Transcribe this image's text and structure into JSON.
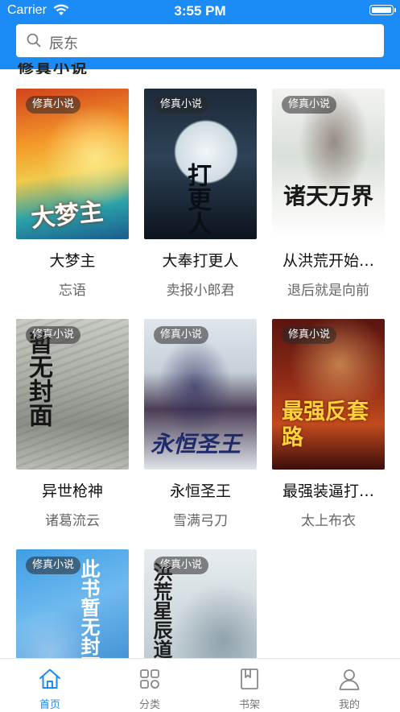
{
  "status_bar": {
    "carrier": "Carrier",
    "time": "3:55 PM"
  },
  "search": {
    "text": "辰东",
    "icon": "search-icon"
  },
  "section_title_partial": "修真小说",
  "books": [
    {
      "tag": "修真小说",
      "title": "大梦主",
      "author": "忘语",
      "cover_text": "大梦主"
    },
    {
      "tag": "修真小说",
      "title": "大奉打更人",
      "author": "卖报小郎君",
      "cover_text": "打更人"
    },
    {
      "tag": "修真小说",
      "title": "从洪荒开始…",
      "author": "退后就是向前",
      "cover_text": "诸天万界"
    },
    {
      "tag": "修真小说",
      "title": "异世枪神",
      "author": "诸葛流云",
      "cover_text": "暂无封面"
    },
    {
      "tag": "修真小说",
      "title": "永恒圣王",
      "author": "雪满弓刀",
      "cover_text": "永恒圣王"
    },
    {
      "tag": "修真小说",
      "title": "最强装逼打…",
      "author": "太上布衣",
      "cover_text": "最强反套路"
    },
    {
      "tag": "修真小说",
      "title": "",
      "author": "",
      "cover_text": "此书暂无封面"
    },
    {
      "tag": "修真小说",
      "title": "",
      "author": "",
      "cover_text": "洪荒星辰道"
    }
  ],
  "tabs": [
    {
      "label": "首页",
      "icon": "home-icon",
      "active": true
    },
    {
      "label": "分类",
      "icon": "grid-icon",
      "active": false
    },
    {
      "label": "书架",
      "icon": "bookshelf-icon",
      "active": false
    },
    {
      "label": "我的",
      "icon": "user-icon",
      "active": false
    }
  ],
  "colors": {
    "accent": "#1b8bf5",
    "tag_bg": "#3a3a3a"
  }
}
